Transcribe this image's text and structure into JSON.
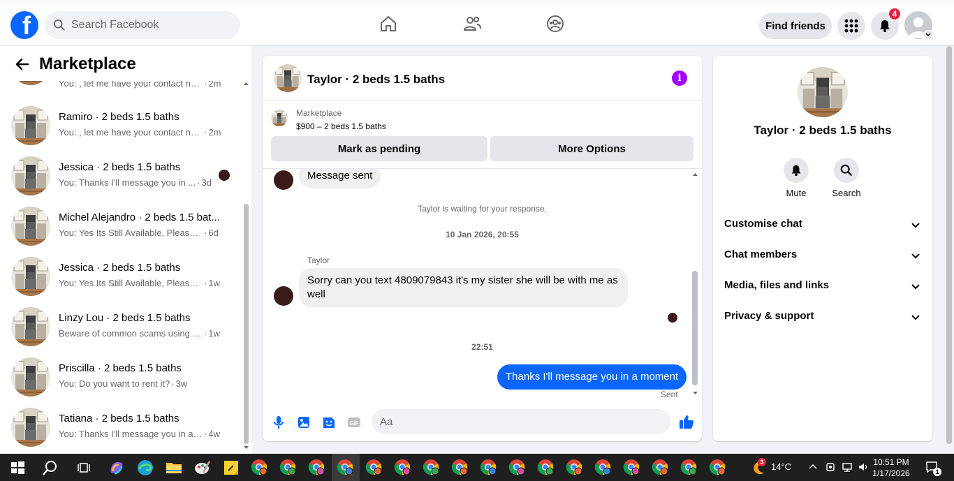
{
  "app": {
    "logo_letter": "f"
  },
  "topnav": {
    "search_placeholder": "Search Facebook",
    "find_friends_label": "Find friends",
    "notification_count": "4",
    "icons": [
      "home-icon",
      "friends-icon",
      "groups-icon",
      "menu-grid-icon",
      "bell-icon",
      "account-icon"
    ]
  },
  "sidebar": {
    "title": "Marketplace",
    "partial_preview": "You: , let me have your contact nu...",
    "partial_time": "2m",
    "conversations": [
      {
        "name": "Ramiro · 2 beds 1.5 baths",
        "preview": "You: , let me have your contact nu...",
        "time": "2m",
        "seen": false
      },
      {
        "name": "Jessica · 2 beds 1.5 baths",
        "preview": "You: Thanks I'll message you in ...",
        "time": "3d",
        "seen": true
      },
      {
        "name": "Michel Alejandro · 2 beds 1.5 bat...",
        "preview": "You: Yes Its Still Available, Please Se...",
        "time": "6d",
        "seen": false
      },
      {
        "name": "Jessica · 2 beds 1.5 baths",
        "preview": "You: Yes Its Still Available, Please Se...",
        "time": "1w",
        "seen": false
      },
      {
        "name": "Linzy Lou · 2 beds 1.5 baths",
        "preview": "Beware of common scams using p...",
        "time": "1w",
        "seen": false
      },
      {
        "name": "Priscilla · 2 beds 1.5 baths",
        "preview": "You: Do you want to rent it?",
        "time": "3w",
        "seen": false
      },
      {
        "name": "Tatiana · 2 beds 1.5 baths",
        "preview": "You: Thanks I'll message you in a ...",
        "time": "4w",
        "seen": false
      }
    ]
  },
  "chat": {
    "title": "Taylor · 2 beds 1.5 baths",
    "listing": {
      "source": "Marketplace",
      "price_line": "$900 – 2 beds 1.5 baths",
      "pending_label": "Mark as pending",
      "options_label": "More Options"
    },
    "messages": {
      "partial_bubble": "Message sent",
      "system_notice": "Taylor is waiting for your response.",
      "timestamp_1": "10 Jan 2026, 20:55",
      "sender_name": "Taylor",
      "incoming_text": "Sorry can you text 4809079843 it's my sister she will be with me as well",
      "timestamp_2": "22:51",
      "outgoing_text": "Thanks I'll message you in a moment",
      "status": "Sent"
    },
    "composer": {
      "placeholder": "Aa",
      "icons": [
        "microphone-icon",
        "photo-icon",
        "sticker-icon",
        "gif-icon",
        "emoji-icon",
        "thumbs-up-icon"
      ]
    }
  },
  "info_panel": {
    "name": "Taylor · 2 beds 1.5 baths",
    "actions": [
      {
        "label": "Mute"
      },
      {
        "label": "Search"
      }
    ],
    "sections": [
      {
        "label": "Customise chat"
      },
      {
        "label": "Chat members"
      },
      {
        "label": "Media, files and links"
      },
      {
        "label": "Privacy & support"
      }
    ]
  },
  "taskbar": {
    "weather_badge": "3",
    "temperature": "14°C",
    "time": "10:51 PM",
    "date": "1/17/2026",
    "notification_count": "1"
  },
  "colors": {
    "brand": "#0866ff",
    "info_accent": "#a100ff",
    "badge": "#e41e3f"
  }
}
